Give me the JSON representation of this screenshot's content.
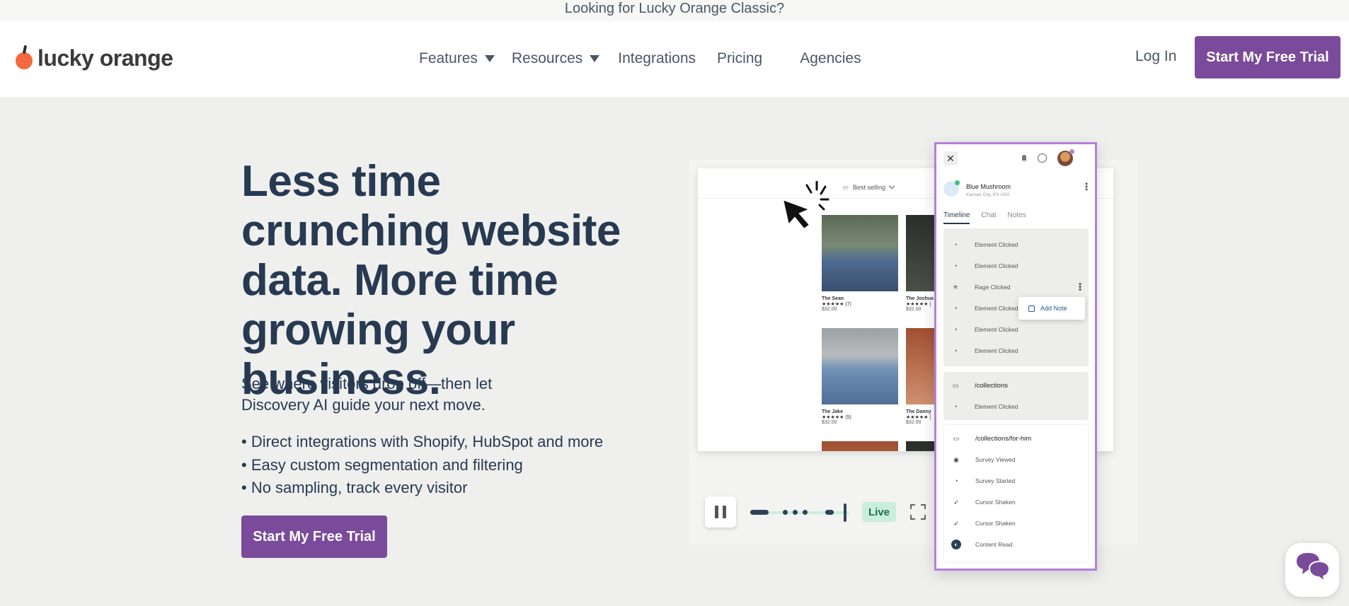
{
  "announcement": "Looking for Lucky Orange Classic?",
  "brand": {
    "name": "lucky orange",
    "accent": "#7a4b9a",
    "orange": "#f26a3d"
  },
  "nav": {
    "items": [
      {
        "label": "Features",
        "dropdown": true
      },
      {
        "label": "Resources",
        "dropdown": true
      },
      {
        "label": "Integrations",
        "dropdown": false
      },
      {
        "label": "Pricing",
        "dropdown": false
      },
      {
        "label": "Agencies",
        "dropdown": false
      }
    ],
    "login": "Log In",
    "cta": "Start My Free Trial"
  },
  "hero": {
    "title": "Less time crunching website data. More time growing your business.",
    "subtitle": "See where visitors drop off—then let Discovery AI guide your next move.",
    "bullets": [
      "• Direct integrations with Shopify, HubSpot and more",
      "• Easy custom segmentation and filtering",
      "• No sampling, track every visitor"
    ],
    "cta": "Start My Free Trial"
  },
  "mock": {
    "sort_label": "Best selling",
    "sort_prefix": "er",
    "products": [
      {
        "name": "The Sean",
        "rating": "★★★★★ (7)",
        "price": "$32.00"
      },
      {
        "name": "The Joshua",
        "rating": "★★★★★ (",
        "price": "$32.00"
      },
      {
        "name": "The Jake",
        "rating": "★★★★★ (5)",
        "price": "$32.00"
      },
      {
        "name": "The Danny",
        "rating": "★★★★★ (",
        "price": "$32.00"
      }
    ],
    "player": {
      "live": "Live"
    },
    "panel": {
      "user_name": "Blue Mushroom",
      "user_location": "Kansas City, KS USA",
      "tabs": [
        "Timeline",
        "Chat",
        "Notes"
      ],
      "section1": [
        "Element Clicked",
        "Element Clicked",
        "Rage Clicked",
        "Element Clicked",
        "Element Clicked",
        "Element Clicked"
      ],
      "add_note": "Add Note",
      "section2_page": "/collections",
      "section2_events": [
        "Element Clicked"
      ],
      "section3_page": "/collections/for-him",
      "section3_events": [
        "Survey Viewed",
        "Survey Started",
        "Cursor Shaken",
        "Cursor Shaken",
        "Content Read"
      ]
    }
  }
}
